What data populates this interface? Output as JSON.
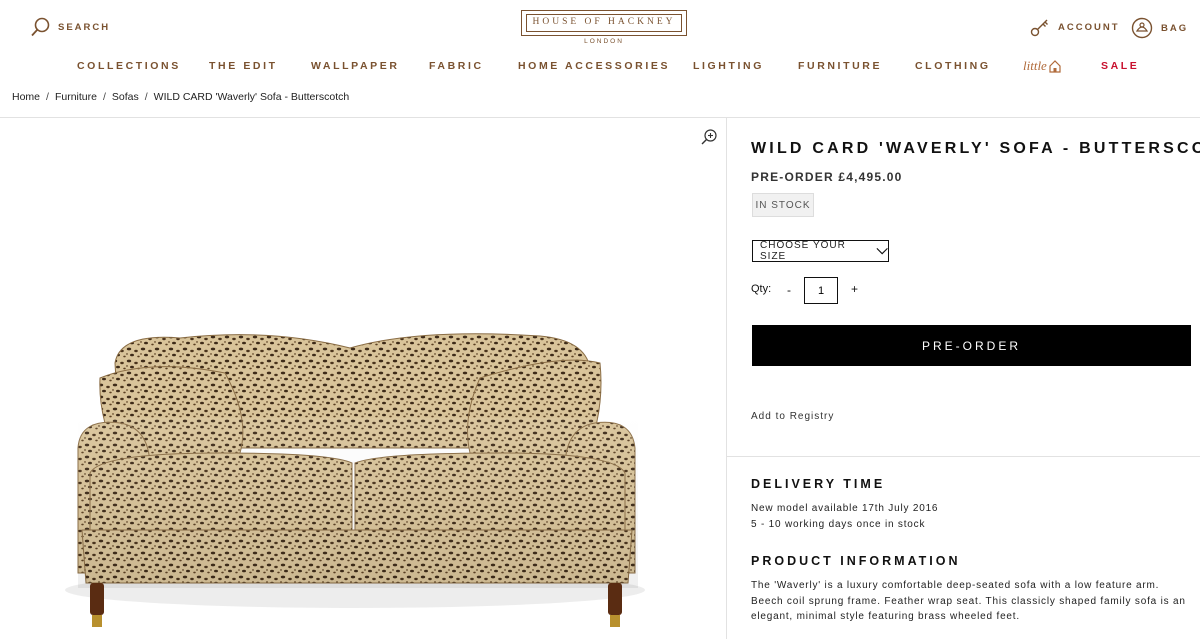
{
  "header": {
    "search_label": "SEARCH",
    "logo_title": "HOUSE OF HACKNEY",
    "logo_sub": "LONDON",
    "account_label": "ACCOUNT",
    "bag_label": "BAG"
  },
  "nav": {
    "items": [
      "COLLECTIONS",
      "THE EDIT",
      "WALLPAPER",
      "FABRIC",
      "HOME ACCESSORIES",
      "LIGHTING",
      "FURNITURE",
      "CLOTHING"
    ],
    "little": "little",
    "sale": "SALE"
  },
  "breadcrumb": [
    "Home",
    "Furniture",
    "Sofas",
    "WILD CARD 'Waverly' Sofa - Butterscotch"
  ],
  "product": {
    "title": "WILD CARD 'WAVERLY' SOFA - BUTTERSCOTCH",
    "price": "PRE-ORDER £4,495.00",
    "stock": "IN STOCK",
    "size_select": "CHOOSE YOUR SIZE",
    "qty_label": "Qty:",
    "qty_minus": "-",
    "qty_value": "1",
    "qty_plus": "+",
    "button": "PRE-ORDER",
    "registry": "Add to Registry"
  },
  "delivery": {
    "heading": "DELIVERY TIME",
    "line1": "New model available 17th July 2016",
    "line2": "5 - 10 working days once in stock"
  },
  "info": {
    "heading": "PRODUCT INFORMATION",
    "text": "The 'Waverly' is a luxury comfortable deep-seated sofa with a low feature arm. Beech coil sprung frame. Feather wrap seat. This classicly shaped family sofa is an elegant, minimal style featuring brass wheeled feet."
  },
  "colors": {
    "brand": "#7a5230",
    "sale": "#c8102e",
    "button": "#000000"
  }
}
